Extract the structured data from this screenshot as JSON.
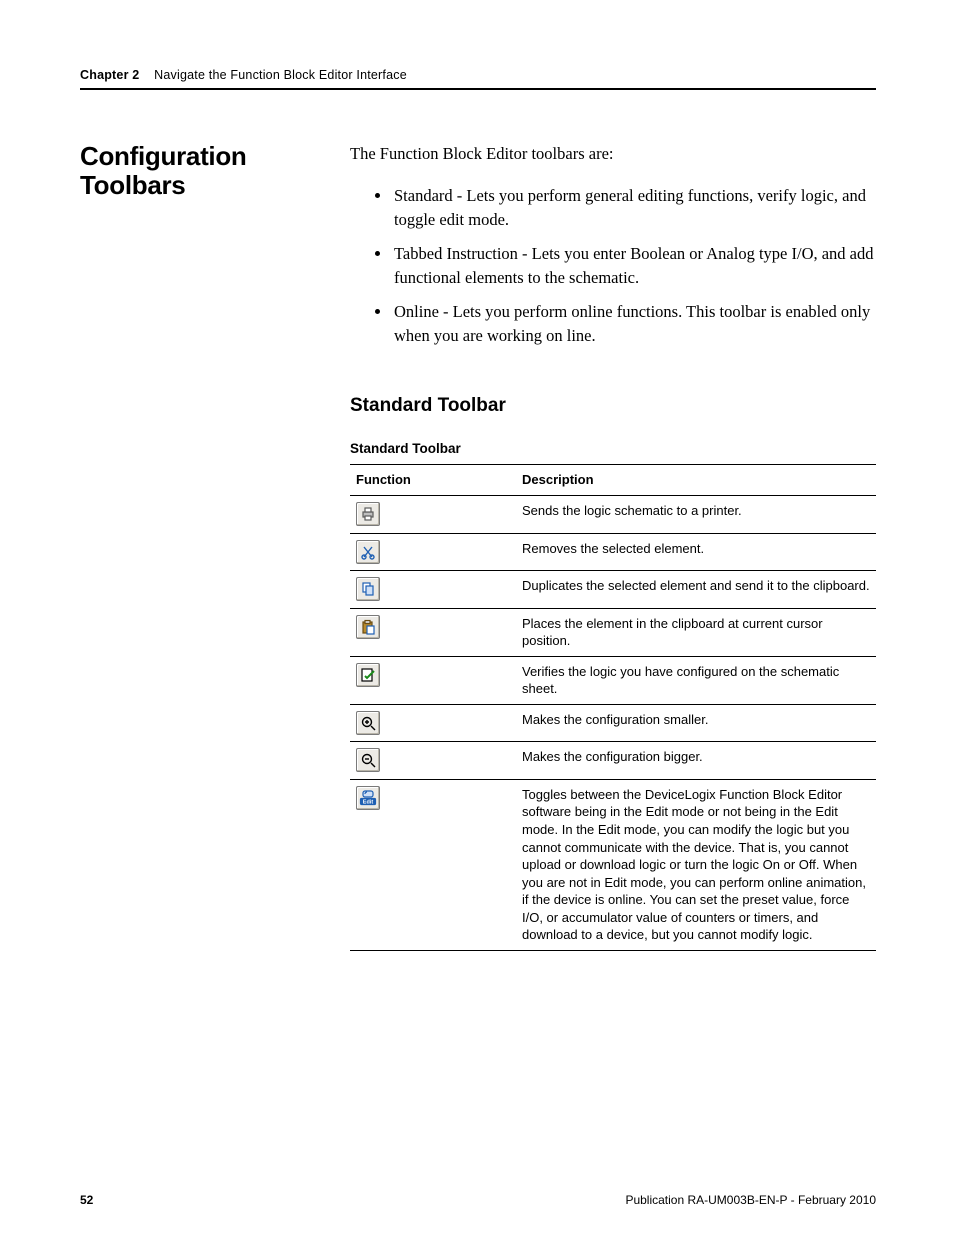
{
  "runningHead": {
    "chapter": "Chapter 2",
    "title": "Navigate the Function Block Editor Interface"
  },
  "sectionTitle": "Configuration Toolbars",
  "intro": "The Function Block Editor toolbars are:",
  "bullets": [
    "Standard - Lets you perform general editing functions, verify logic, and toggle edit mode.",
    "Tabbed Instruction - Lets you enter Boolean or Analog type I/O, and add functional elements to the schematic.",
    "Online - Lets you perform online functions. This toolbar is enabled only when you are working on line."
  ],
  "subheading": "Standard Toolbar",
  "tableCaption": "Standard Toolbar",
  "table": {
    "headers": [
      "Function",
      "Description"
    ],
    "rows": [
      {
        "icon": "print-icon",
        "desc": "Sends the logic schematic to a printer."
      },
      {
        "icon": "cut-icon",
        "desc": "Removes the selected element."
      },
      {
        "icon": "copy-icon",
        "desc": "Duplicates the selected element and send it to the clipboard."
      },
      {
        "icon": "paste-icon",
        "desc": "Places the element in the clipboard at current cursor position."
      },
      {
        "icon": "verify-icon",
        "desc": "Verifies the logic you have configured on the schematic sheet."
      },
      {
        "icon": "zoom-in-icon",
        "desc": "Makes the configuration smaller."
      },
      {
        "icon": "zoom-out-icon",
        "desc": "Makes the configuration bigger."
      },
      {
        "icon": "edit-toggle-icon",
        "desc": "Toggles between the DeviceLogix Function Block Editor software being in the Edit mode or not being in the Edit mode. In the Edit mode, you can modify the logic but you cannot communicate with the device. That is, you cannot upload or download logic or turn the logic On or Off. When you are not in Edit mode, you can perform online animation, if the device is online. You can set the preset value, force I/O, or accumulator value of counters or timers, and download to a device, but you cannot modify logic."
      }
    ]
  },
  "footer": {
    "pageNum": "52",
    "pubLine": "Publication RA-UM003B-EN-P - February 2010"
  }
}
